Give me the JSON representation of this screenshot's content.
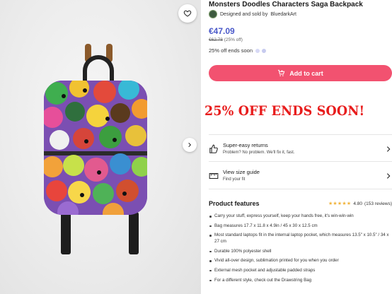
{
  "product": {
    "title": "Monsters Doodles Characters Saga Backpack",
    "seller_prefix": "Designed and sold by",
    "seller_name": "BluedarkArt",
    "price": "€47.09",
    "old_price": "€62.78",
    "discount": "(25% off)",
    "ends_text": "25% off ends soon",
    "add_to_cart": "Add to cart",
    "promo_banner": "25% OFF ENDS SOON!",
    "accent_color": "#4a59c9",
    "cart_color": "#f25270",
    "promo_color": "#e81c1c"
  },
  "features": [
    {
      "icon": "thumbs-up-icon",
      "title": "Super-easy returns",
      "subtitle": "Problem? No problem. We'll fix it, fast."
    },
    {
      "icon": "ruler-icon",
      "title": "View size guide",
      "subtitle": "Find your fit"
    }
  ],
  "product_features": {
    "title": "Product features",
    "rating_value": "4.80",
    "rating_count": "(153 reviews)",
    "stars": "★★★★★",
    "bullets": [
      "Carry your stuff, express yourself, keep your hands free, it's win-win-win",
      "Bag measures 17.7 x 11.8 x 4.9in / 45 x 30 x 12.5 cm",
      "Most standard laptops fit in the internal laptop pocket, which measures 13.5\" x 10.5\" / 34 x 27 cm",
      "Durable 100% polyester shell",
      "Vivid all-over design, sublimation printed for you when you order",
      "External mesh pocket and adjustable padded straps",
      "For a different style, check out the Drawstring Bag"
    ]
  },
  "gallery": {
    "favorite_icon": "heart-icon",
    "next_icon": "chevron-right-icon"
  }
}
